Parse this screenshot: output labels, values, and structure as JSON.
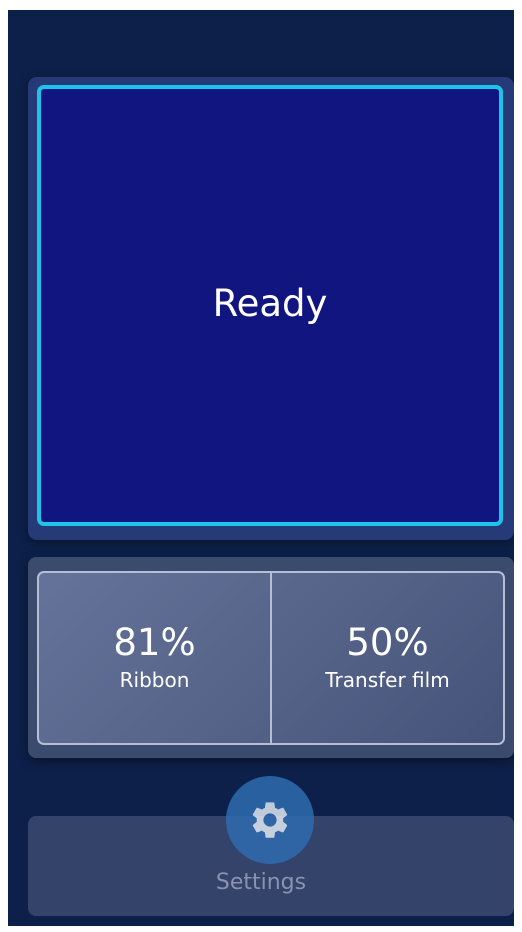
{
  "status": {
    "text": "Ready"
  },
  "consumables": [
    {
      "value": "81%",
      "label": "Ribbon"
    },
    {
      "value": "50%",
      "label": "Transfer film"
    }
  ],
  "settings": {
    "label": "Settings",
    "icon": "gear-icon"
  },
  "colors": {
    "background": "#0d2049",
    "status_fill": "#111580",
    "status_border": "#1ec3ea",
    "gauge_panel": "#56648a",
    "settings_icon": "#2f6cb0"
  }
}
